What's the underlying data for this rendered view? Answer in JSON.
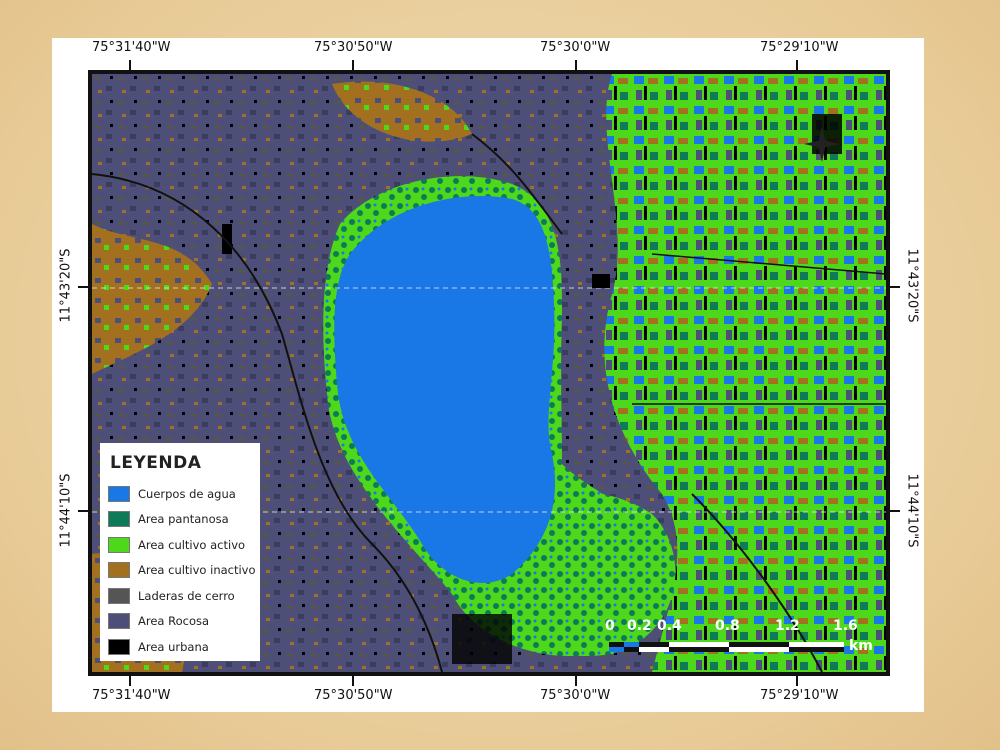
{
  "coordinates": {
    "top": [
      "75°31'40\"W",
      "75°30'50\"W",
      "75°30'0\"W",
      "75°29'10\"W"
    ],
    "bottom": [
      "75°31'40\"W",
      "75°30'50\"W",
      "75°30'0\"W",
      "75°29'10\"W"
    ],
    "left": [
      "11°43'20\"S",
      "11°44'10\"S"
    ],
    "right": [
      "11°43'20\"S",
      "11°44'10\"S"
    ]
  },
  "legend": {
    "title": "LEYENDA",
    "items": [
      {
        "label": "Cuerpos de agua",
        "color": "#1a78e6"
      },
      {
        "label": "Area pantanosa",
        "color": "#0e7a57"
      },
      {
        "label": "Area cultivo activo",
        "color": "#4ed81c"
      },
      {
        "label": "Area cultivo inactivo",
        "color": "#a2701f"
      },
      {
        "label": "Laderas de cerro",
        "color": "#555555"
      },
      {
        "label": "Area Rocosa",
        "color": "#4d4f79"
      },
      {
        "label": "Area urbana",
        "color": "#000000"
      }
    ]
  },
  "scale": {
    "labels": [
      "0",
      "0.2",
      "0.4",
      "0.8",
      "1.2",
      "1.6"
    ],
    "unit": "km"
  },
  "colors": {
    "water": "#1a78e6",
    "marsh": "#0e7a57",
    "active_crop": "#4ed81c",
    "inactive_crop": "#a2701f",
    "hills": "#555555",
    "rocky": "#4d4f79",
    "urban": "#000000"
  }
}
